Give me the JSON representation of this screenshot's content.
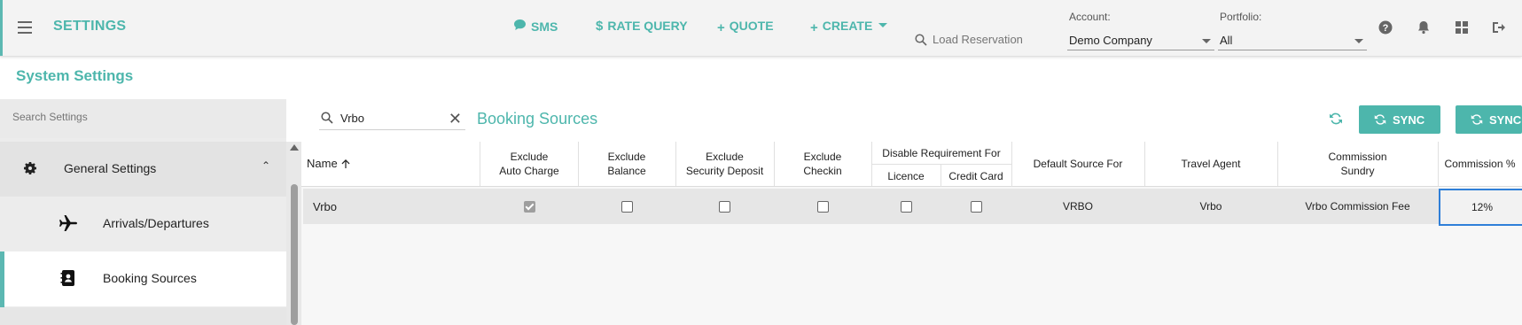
{
  "header": {
    "app_title": "SETTINGS",
    "nav": {
      "sms": "SMS",
      "rate_query": "RATE QUERY",
      "quote": "QUOTE",
      "create": "CREATE"
    },
    "load_reservation_placeholder": "Load Reservation",
    "account": {
      "label": "Account:",
      "value": "Demo Company"
    },
    "portfolio": {
      "label": "Portfolio:",
      "value": "All"
    },
    "icons": [
      "help-icon",
      "bell-icon",
      "grid-icon",
      "logout-icon"
    ]
  },
  "page_title": "System Settings",
  "sidebar": {
    "search_placeholder": "Search Settings",
    "items": [
      {
        "label": "General Settings",
        "icon": "gear-icon"
      },
      {
        "label": "Arrivals/Departures",
        "icon": "airplane-icon"
      },
      {
        "label": "Booking Sources",
        "icon": "contact-book-icon"
      }
    ]
  },
  "main": {
    "search_value": "Vrbo",
    "section_title": "Booking Sources",
    "sync_label": "SYNC",
    "sync2_label": "SYNC"
  },
  "table": {
    "headers": {
      "name": "Name",
      "exclude_auto_charge": [
        "Exclude",
        "Auto Charge"
      ],
      "exclude_balance": [
        "Exclude",
        "Balance"
      ],
      "exclude_security_deposit": [
        "Exclude",
        "Security Deposit"
      ],
      "exclude_checkin": [
        "Exclude",
        "Checkin"
      ],
      "disable_requirement_for": "Disable Requirement For",
      "licence": "Licence",
      "credit_card": "Credit Card",
      "default_source_for": "Default Source For",
      "travel_agent": "Travel Agent",
      "commission_sundry": [
        "Commission",
        "Sundry"
      ],
      "commission_pct": "Commission %"
    },
    "rows": [
      {
        "name": "Vrbo",
        "exclude_auto_charge": true,
        "exclude_balance": false,
        "exclude_security_deposit": false,
        "exclude_checkin": false,
        "licence": false,
        "credit_card": false,
        "default_source_for": "VRBO",
        "travel_agent": "Vrbo",
        "commission_sundry": "Vrbo Commission Fee",
        "commission_pct": "12%"
      }
    ]
  },
  "colors": {
    "accent": "#4db6ac",
    "selection_border": "#2f7fd8"
  }
}
